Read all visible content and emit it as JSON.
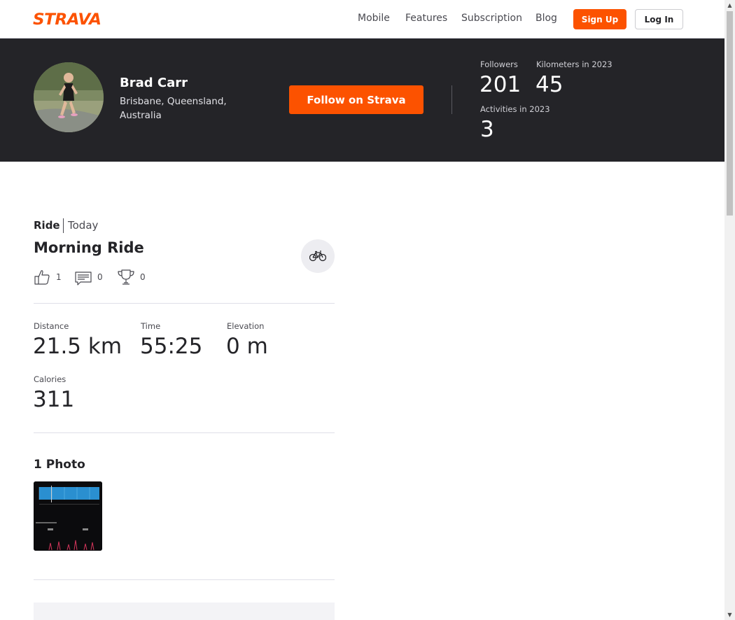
{
  "nav": {
    "logo": "STRAVA",
    "links": [
      "Mobile",
      "Features",
      "Subscription",
      "Blog"
    ],
    "signup": "Sign Up",
    "login": "Log In"
  },
  "athlete": {
    "name": "Brad Carr",
    "location": "Brisbane, Queensland, Australia",
    "follow_button": "Follow on Strava",
    "stats": {
      "followers_label": "Followers",
      "followers_value": "201",
      "km_label": "Kilometers in 2023",
      "km_value": "45",
      "activities_label": "Activities in 2023",
      "activities_value": "3"
    }
  },
  "activity": {
    "type": "Ride",
    "date": "Today",
    "title": "Morning Ride",
    "kudos": "1",
    "comments": "0",
    "achievements": "0",
    "metrics": {
      "distance_label": "Distance",
      "distance_value": "21.5 km",
      "time_label": "Time",
      "time_value": "55:25",
      "elevation_label": "Elevation",
      "elevation_value": "0 m",
      "calories_label": "Calories",
      "calories_value": "311"
    },
    "photos_title": "1 Photo"
  },
  "colors": {
    "brand": "#fc5200",
    "header_bg": "#242428"
  },
  "icons": {
    "sport": "bike-icon",
    "kudos": "thumbs-up-icon",
    "comments": "comment-icon",
    "achievements": "trophy-icon"
  }
}
